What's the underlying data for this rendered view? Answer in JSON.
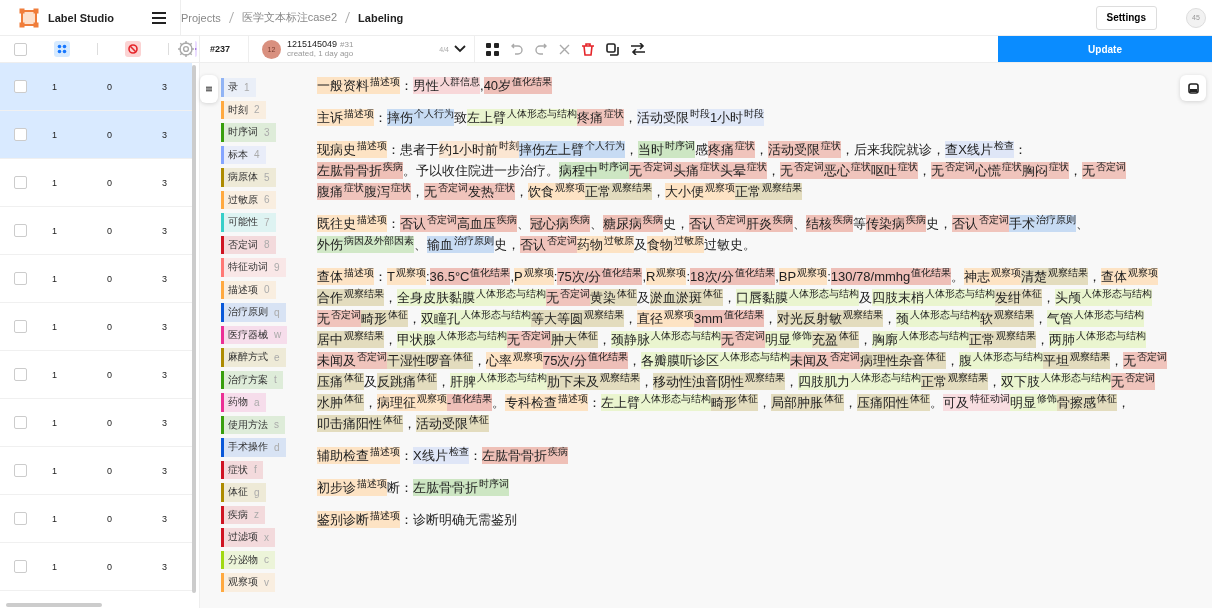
{
  "topbar": {
    "app_name": "Label Studio",
    "breadcrumb": [
      "Projects",
      "医学文本标注case2",
      "Labeling"
    ],
    "settings_button": "Settings",
    "user_avatar": "45"
  },
  "task_list": {
    "select_all": {
      "checked": false
    },
    "rows": [
      {
        "selected": true,
        "cells": [
          "1",
          "0",
          "3"
        ]
      },
      {
        "selected": true,
        "cells": [
          "1",
          "0",
          "3"
        ]
      },
      {
        "selected": false,
        "cells": [
          "1",
          "0",
          "3"
        ]
      },
      {
        "selected": false,
        "cells": [
          "1",
          "0",
          "3"
        ]
      },
      {
        "selected": false,
        "cells": [
          "1",
          "0",
          "3"
        ]
      },
      {
        "selected": false,
        "cells": [
          "1",
          "0",
          "3"
        ]
      },
      {
        "selected": false,
        "cells": [
          "1",
          "0",
          "3"
        ]
      },
      {
        "selected": false,
        "cells": [
          "1",
          "0",
          "3"
        ]
      },
      {
        "selected": false,
        "cells": [
          "1",
          "0",
          "3"
        ]
      },
      {
        "selected": false,
        "cells": [
          "1",
          "0",
          "3"
        ]
      },
      {
        "selected": false,
        "cells": [
          "1",
          "0",
          "3"
        ]
      }
    ]
  },
  "toolbar": {
    "task_id": "#237",
    "avatar": "12",
    "annotator": "1215145049",
    "annotation_id": "#31",
    "created": "created, 1 day ago",
    "counter": "4/4",
    "update_button": "Update"
  },
  "labels": [
    {
      "name": "录",
      "hotkey": "1",
      "color": "#91b4f5"
    },
    {
      "name": "时刻",
      "hotkey": "2",
      "color": "#ffa940"
    },
    {
      "name": "时序词",
      "hotkey": "3",
      "color": "#389e0d"
    },
    {
      "name": "标本",
      "hotkey": "4",
      "color": "#85a5ff"
    },
    {
      "name": "病原体",
      "hotkey": "5",
      "color": "#ad8b00"
    },
    {
      "name": "过敏原",
      "hotkey": "6",
      "color": "#ffa940"
    },
    {
      "name": "可能性",
      "hotkey": "7",
      "color": "#36cfc9"
    },
    {
      "name": "否定词",
      "hotkey": "8",
      "color": "#cf1322"
    },
    {
      "name": "特征动词",
      "hotkey": "9",
      "color": "#ff7875"
    },
    {
      "name": "描述项",
      "hotkey": "0",
      "color": "#ffa940"
    },
    {
      "name": "治疗原则",
      "hotkey": "q",
      "color": "#0958d9"
    },
    {
      "name": "医疗器械",
      "hotkey": "w",
      "color": "#eb2f96"
    },
    {
      "name": "麻醉方式",
      "hotkey": "e",
      "color": "#ad8b00"
    },
    {
      "name": "治疗方案",
      "hotkey": "t",
      "color": "#389e0d"
    },
    {
      "name": "药物",
      "hotkey": "a",
      "color": "#eb2f96"
    },
    {
      "name": "使用方法",
      "hotkey": "s",
      "color": "#389e0d"
    },
    {
      "name": "手术操作",
      "hotkey": "d",
      "color": "#0958d9"
    },
    {
      "name": "症状",
      "hotkey": "f",
      "color": "#cf1322"
    },
    {
      "name": "体征",
      "hotkey": "g",
      "color": "#ad8b00"
    },
    {
      "name": "疾病",
      "hotkey": "z",
      "color": "#cf1322"
    },
    {
      "name": "过滤项",
      "hotkey": "x",
      "color": "#cf1322"
    },
    {
      "name": "分泌物",
      "hotkey": "c",
      "color": "#a0d911"
    },
    {
      "name": "观察项",
      "hotkey": "v",
      "color": "#ffa940"
    }
  ],
  "paragraphs": [
    [
      {
        "text": "一般资料",
        "label": "描述项",
        "color": "#fde3c4"
      },
      "：",
      {
        "text": "男性",
        "label": "人群信息",
        "color": "#f8d7d9"
      },
      ",",
      {
        "text": "40岁",
        "label": "值化结果",
        "color": "#eebfb8"
      }
    ],
    [
      {
        "text": "主诉",
        "label": "描述项",
        "color": "#fde3c4"
      },
      "：",
      {
        "text": "摔伤",
        "label": "个人行为",
        "color": "#c7dbf3"
      },
      "致",
      {
        "text": "左上臂",
        "label": "人体形态与结构",
        "color": "#eaf5cf"
      },
      {
        "text": "疼痛",
        "label": "症状",
        "color": "#f0c4bc"
      },
      "，",
      {
        "text": "活动受限",
        "label": "时段",
        "color": "#e6ecf9"
      },
      {
        "text": "1小时",
        "label": "时段",
        "color": "#e0e8f8"
      }
    ],
    [
      {
        "text": "现病史",
        "label": "描述项",
        "color": "#fde3c4"
      },
      "：患者于",
      {
        "text": "约1小时前",
        "label": "时刻",
        "color": "#fbe6d2"
      },
      {
        "text": "摔伤左上臂",
        "label": "个人行为",
        "color": "#c7dbf3"
      },
      "，",
      {
        "text": "当时",
        "label": "时序词",
        "color": "#cde6c3"
      },
      "感",
      {
        "text": "疼痛",
        "label": "症状",
        "color": "#f0c4bc"
      },
      "，",
      {
        "text": "活动受限",
        "label": "症状",
        "color": "#f0c4bc"
      },
      "，后来我院就诊，",
      {
        "text": "查X线片",
        "label": "检查",
        "color": "#dfe6f7"
      },
      "：",
      {
        "text": "左肱骨骨折",
        "label": "疾病",
        "color": "#efc0b7"
      },
      "。予以收住院进一步治疗。",
      {
        "text": "病程中",
        "label": "时序词",
        "color": "#cde6c3"
      },
      {
        "text": "无",
        "label": "否定词",
        "color": "#f0c4bc"
      },
      {
        "text": "头痛",
        "label": "症状",
        "color": "#f0c4bc"
      },
      {
        "text": "头晕",
        "label": "症状",
        "color": "#f0c4bc"
      },
      "，",
      {
        "text": "无",
        "label": "否定词",
        "color": "#f0c4bc"
      },
      {
        "text": "恶心",
        "label": "症状",
        "color": "#f0c4bc"
      },
      {
        "text": "呕吐",
        "label": "症状",
        "color": "#f0c4bc"
      },
      "，",
      {
        "text": "无",
        "label": "否定词",
        "color": "#f0c4bc"
      },
      {
        "text": "心慌",
        "label": "症状",
        "color": "#f0c4bc"
      },
      {
        "text": "胸闷",
        "label": "症状",
        "color": "#f0c4bc"
      },
      "，",
      {
        "text": "无",
        "label": "否定词",
        "color": "#f0c4bc"
      },
      {
        "text": "腹痛",
        "label": "症状",
        "color": "#f0c4bc"
      },
      {
        "text": "腹泻",
        "label": "症状",
        "color": "#f0c4bc"
      },
      "，",
      {
        "text": "无",
        "label": "否定词",
        "color": "#f0c4bc"
      },
      {
        "text": "发热",
        "label": "症状",
        "color": "#f0c4bc"
      },
      "，",
      {
        "text": "饮食",
        "label": "观察项",
        "color": "#fde3c4"
      },
      {
        "text": "正常",
        "label": "观察结果",
        "color": "#e3dcbe"
      },
      "，",
      {
        "text": "大小便",
        "label": "观察项",
        "color": "#fde3c4"
      },
      {
        "text": "正常",
        "label": "观察结果",
        "color": "#e3dcbe"
      }
    ],
    [
      {
        "text": "既往史",
        "label": "描述项",
        "color": "#fde3c4"
      },
      "：",
      {
        "text": "否认",
        "label": "否定词",
        "color": "#f0c4bc"
      },
      {
        "text": "高血压",
        "label": "疾病",
        "color": "#efc0b7"
      },
      "、",
      {
        "text": "冠心病",
        "label": "疾病",
        "color": "#efc0b7"
      },
      "、",
      {
        "text": "糖尿病",
        "label": "疾病",
        "color": "#efc0b7"
      },
      "史，",
      {
        "text": "否认",
        "label": "否定词",
        "color": "#f0c4bc"
      },
      {
        "text": "肝炎",
        "label": "疾病",
        "color": "#efc0b7"
      },
      "、",
      {
        "text": "结核",
        "label": "疾病",
        "color": "#efc0b7"
      },
      "等",
      {
        "text": "传染病",
        "label": "疾病",
        "color": "#efc0b7"
      },
      "史，",
      {
        "text": "否认",
        "label": "否定词",
        "color": "#f0c4bc"
      },
      {
        "text": "手术",
        "label": "治疗原则",
        "color": "#c7dbf3"
      },
      "、",
      {
        "text": "外伤",
        "label": "病因及外部因素",
        "color": "#d1e8c7"
      },
      "、",
      {
        "text": "输血",
        "label": "治疗原则",
        "color": "#c7dbf3"
      },
      "史，",
      {
        "text": "否认",
        "label": "否定词",
        "color": "#f0c4bc"
      },
      {
        "text": "药物",
        "label": "过敏原",
        "color": "#fde3c4"
      },
      "及",
      {
        "text": "食物",
        "label": "过敏原",
        "color": "#fde3c4"
      },
      "过敏史。"
    ],
    [
      {
        "text": "查体",
        "label": "描述项",
        "color": "#fde3c4"
      },
      "：",
      {
        "text": "T",
        "label": "观察项",
        "color": "#fde3c4"
      },
      ":",
      {
        "text": "36.5°C",
        "label": "值化结果",
        "color": "#eebfb8"
      },
      ",",
      {
        "text": "P",
        "label": "观察项",
        "color": "#fde3c4"
      },
      ":",
      {
        "text": "75次/分",
        "label": "值化结果",
        "color": "#eebfb8"
      },
      ",",
      {
        "text": "R",
        "label": "观察项",
        "color": "#fde3c4"
      },
      ":",
      {
        "text": "18次/分",
        "label": "值化结果",
        "color": "#eebfb8"
      },
      ",",
      {
        "text": "BP",
        "label": "观察项",
        "color": "#fde3c4"
      },
      ":",
      {
        "text": "130/78/mmhg",
        "label": "值化结果",
        "color": "#eebfb8"
      },
      "。",
      {
        "text": "神志",
        "label": "观察项",
        "color": "#fde3c4"
      },
      {
        "text": "清楚",
        "label": "观察结果",
        "color": "#e3dcbe"
      },
      "，",
      {
        "text": "查体",
        "label": "观察项",
        "color": "#fde3c4"
      },
      {
        "text": "合作",
        "label": "观察结果",
        "color": "#e3dcbe"
      },
      "，",
      {
        "text": "全身皮肤黏膜",
        "label": "人体形态与结构",
        "color": "#eaf5cf"
      },
      {
        "text": "无",
        "label": "否定词",
        "color": "#f0c4bc"
      },
      {
        "text": "黄染",
        "label": "体征",
        "color": "#e3dcbe"
      },
      "及",
      {
        "text": "淤血淤斑",
        "label": "体征",
        "color": "#e3dcbe"
      },
      "，",
      {
        "text": "口唇黏膜",
        "label": "人体形态与结构",
        "color": "#eaf5cf"
      },
      "及",
      {
        "text": "四肢末梢",
        "label": "人体形态与结构",
        "color": "#eaf5cf"
      },
      {
        "text": "发绀",
        "label": "体征",
        "color": "#e3dcbe"
      },
      "，",
      {
        "text": "头颅",
        "label": "人体形态与结构",
        "color": "#eaf5cf"
      },
      {
        "text": "无",
        "label": "否定词",
        "color": "#f0c4bc"
      },
      {
        "text": "畸形",
        "label": "体征",
        "color": "#e3dcbe"
      },
      "，",
      {
        "text": "双瞳孔",
        "label": "人体形态与结构",
        "color": "#eaf5cf"
      },
      {
        "text": "等大等圆",
        "label": "观察结果",
        "color": "#e3dcbe"
      },
      "，",
      {
        "text": "直径",
        "label": "观察项",
        "color": "#fde3c4"
      },
      {
        "text": "3mm",
        "label": "值化结果",
        "color": "#eebfb8"
      },
      "，",
      {
        "text": "对光反射敏",
        "label": "观察结果",
        "color": "#e3dcbe"
      },
      "，",
      {
        "text": "颈",
        "label": "人体形态与结构",
        "color": "#eaf5cf"
      },
      {
        "text": "软",
        "label": "观察结果",
        "color": "#e3dcbe"
      },
      "，",
      {
        "text": "气管",
        "label": "人体形态与结构",
        "color": "#eaf5cf"
      },
      {
        "text": "居中",
        "label": "观察结果",
        "color": "#e3dcbe"
      },
      "，",
      {
        "text": "甲状腺",
        "label": "人体形态与结构",
        "color": "#eaf5cf"
      },
      {
        "text": "无",
        "label": "否定词",
        "color": "#f0c4bc"
      },
      {
        "text": "肿大",
        "label": "体征",
        "color": "#e3dcbe"
      },
      "，",
      {
        "text": "颈静脉",
        "label": "人体形态与结构",
        "color": "#eaf5cf"
      },
      {
        "text": "无",
        "label": "否定词",
        "color": "#f0c4bc"
      },
      {
        "text": "明显",
        "label": "修饰",
        "color": "#eaf5cf"
      },
      {
        "text": "充盈",
        "label": "体征",
        "color": "#e3dcbe"
      },
      "，",
      {
        "text": "胸廓",
        "label": "人体形态与结构",
        "color": "#eaf5cf"
      },
      {
        "text": "正常",
        "label": "观察结果",
        "color": "#e3dcbe"
      },
      "，",
      {
        "text": "两肺",
        "label": "人体形态与结构",
        "color": "#eaf5cf"
      },
      {
        "text": "未闻及",
        "label": "否定词",
        "color": "#f0c4bc"
      },
      {
        "text": "干湿性啰音",
        "label": "体征",
        "color": "#e3dcbe"
      },
      "，",
      {
        "text": "心率",
        "label": "观察项",
        "color": "#fde3c4"
      },
      {
        "text": "75次/分",
        "label": "值化结果",
        "color": "#eebfb8"
      },
      "，",
      {
        "text": "各瓣膜听诊区",
        "label": "人体形态与结构",
        "color": "#eaf5cf"
      },
      {
        "text": "未闻及",
        "label": "否定词",
        "color": "#f0c4bc"
      },
      {
        "text": "病理性杂音",
        "label": "体征",
        "color": "#e3dcbe"
      },
      "，",
      {
        "text": "腹",
        "label": "人体形态与结构",
        "color": "#eaf5cf"
      },
      {
        "text": "平坦",
        "label": "观察结果",
        "color": "#e3dcbe"
      },
      "，",
      {
        "text": "无",
        "label": "否定词",
        "color": "#f0c4bc"
      },
      {
        "text": "压痛",
        "label": "体征",
        "color": "#e3dcbe"
      },
      "及",
      {
        "text": "反跳痛",
        "label": "体征",
        "color": "#e3dcbe"
      },
      "，",
      {
        "text": "肝脾",
        "label": "人体形态与结构",
        "color": "#eaf5cf"
      },
      {
        "text": "肋下未及",
        "label": "观察结果",
        "color": "#e3dcbe"
      },
      "，",
      {
        "text": "移动性浊音阴性",
        "label": "观察结果",
        "color": "#e3dcbe"
      },
      "，",
      {
        "text": "四肢肌力",
        "label": "人体形态与结构",
        "color": "#eaf5cf"
      },
      {
        "text": "正常",
        "label": "观察结果",
        "color": "#e3dcbe"
      },
      "，",
      {
        "text": "双下肢",
        "label": "人体形态与结构",
        "color": "#eaf5cf"
      },
      {
        "text": "无",
        "label": "否定词",
        "color": "#f0c4bc"
      },
      {
        "text": "水肿",
        "label": "体征",
        "color": "#e3dcbe"
      },
      "，",
      {
        "text": "病理征",
        "label": "观察项",
        "color": "#fde3c4"
      },
      {
        "text": "-",
        "label": "值化结果",
        "color": "#eebfb8"
      },
      "。",
      {
        "text": "专科检查",
        "label": "描述项",
        "color": "#fde3c4"
      },
      "：",
      {
        "text": "左上臂",
        "label": "人体形态与结构",
        "color": "#eaf5cf"
      },
      {
        "text": "畸形",
        "label": "体征",
        "color": "#e3dcbe"
      },
      "，",
      {
        "text": "局部肿胀",
        "label": "体征",
        "color": "#e3dcbe"
      },
      "，",
      {
        "text": "压痛阳性",
        "label": "体征",
        "color": "#e3dcbe"
      },
      "。",
      {
        "text": "可及",
        "label": "特征动词",
        "color": "#f8dde0"
      },
      {
        "text": "明显",
        "label": "修饰",
        "color": "#eaf5cf"
      },
      {
        "text": "骨擦感",
        "label": "体征",
        "color": "#e3dcbe"
      },
      "，",
      {
        "text": "叩击痛阳性",
        "label": "体征",
        "color": "#e3dcbe"
      },
      "，",
      {
        "text": "活动受限",
        "label": "体征",
        "color": "#e3dcbe"
      }
    ],
    [
      {
        "text": "辅助检查",
        "label": "描述项",
        "color": "#fde3c4"
      },
      "：",
      {
        "text": "X线片",
        "label": "检查",
        "color": "#dfe6f7"
      },
      "：",
      {
        "text": "左肱骨骨折",
        "label": "疾病",
        "color": "#efc0b7"
      }
    ],
    [
      {
        "text": "初步诊",
        "label": "描述项",
        "color": "#fde3c4"
      },
      "断：",
      {
        "text": "左肱骨骨折",
        "label": "时序词",
        "color": "#cde6c3"
      }
    ],
    [
      {
        "text": "鉴别诊断",
        "label": "描述项",
        "color": "#fde3c4"
      },
      "：诊断明确无需鉴别"
    ]
  ]
}
